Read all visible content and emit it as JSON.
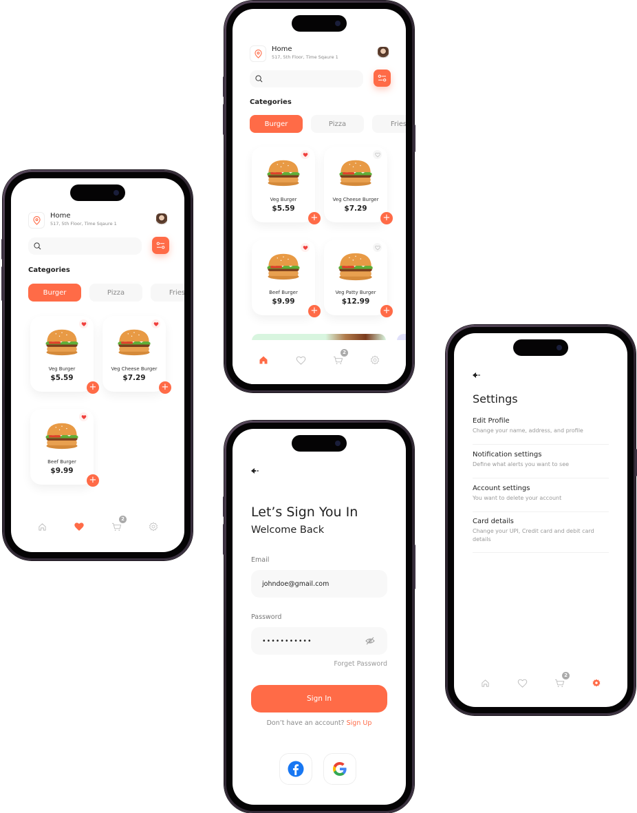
{
  "colors": {
    "accent": "#ff6b47",
    "muted": "#aaaaaa",
    "text": "#222222"
  },
  "home": {
    "location_title": "Home",
    "location_address": "517, 5th Floor, Time Sqaure 1",
    "search_placeholder": "",
    "categories_title": "Categories",
    "categories": [
      {
        "label": "Burger",
        "active": true
      },
      {
        "label": "Pizza",
        "active": false
      },
      {
        "label": "Fries",
        "active": false
      }
    ],
    "products": [
      {
        "name": "Veg Burger",
        "price": "$5.59",
        "favorite": true
      },
      {
        "name": "Veg Cheese Burger",
        "price": "$7.29",
        "favorite": false
      },
      {
        "name": "Beef Burger",
        "price": "$9.99",
        "favorite": true
      },
      {
        "name": "Veg Patty Burger",
        "price": "$12.99",
        "favorite": false
      }
    ],
    "cart_count": "2",
    "active_tab": "home"
  },
  "favorites": {
    "location_title": "Home",
    "location_address": "517, 5th Floor, Time Sqaure 1",
    "categories_title": "Categories",
    "categories": [
      {
        "label": "Burger",
        "active": true
      },
      {
        "label": "Pizza",
        "active": false
      },
      {
        "label": "Fries",
        "active": false
      }
    ],
    "products": [
      {
        "name": "Veg Burger",
        "price": "$5.59",
        "favorite": true
      },
      {
        "name": "Veg Cheese Burger",
        "price": "$7.29",
        "favorite": true
      },
      {
        "name": "Beef Burger",
        "price": "$9.99",
        "favorite": true
      }
    ],
    "cart_count": "2",
    "active_tab": "favorites"
  },
  "signin": {
    "title": "Let’s Sign You In",
    "subtitle": "Welcome Back",
    "email_label": "Email",
    "email_value": "johndoe@gmail.com",
    "password_label": "Password",
    "password_value": "•••••••••••",
    "forgot_label": "Forget Password",
    "signin_button": "Sign In",
    "no_account_text": "Don’t have an account?",
    "signup_link": "Sign Up"
  },
  "settings": {
    "title": "Settings",
    "items": [
      {
        "title": "Edit Profile",
        "desc": "Change your name, address, and profile"
      },
      {
        "title": "Notification settings",
        "desc": "Define what alerts you want to see"
      },
      {
        "title": "Account settings",
        "desc": "You want to delete your account"
      },
      {
        "title": "Card details",
        "desc": "Change your UPI, Credit card and debit card details"
      }
    ],
    "cart_count": "2",
    "active_tab": "settings"
  }
}
